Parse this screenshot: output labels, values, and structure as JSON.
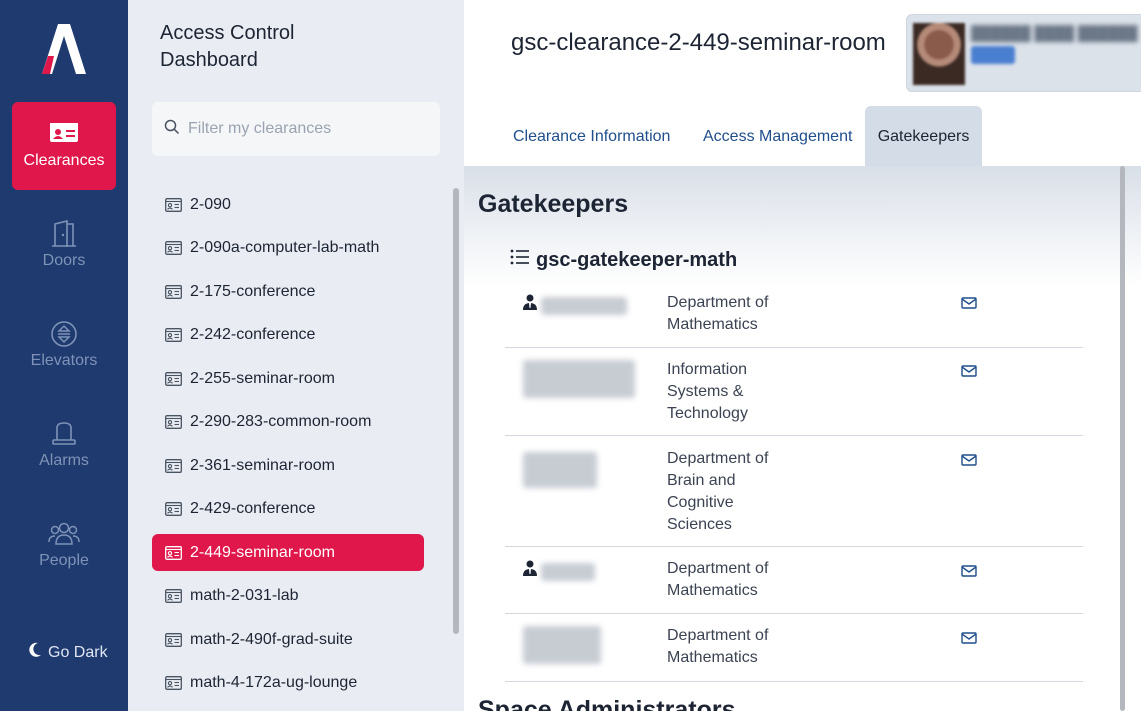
{
  "nav": {
    "items": [
      {
        "label": "Clearances",
        "icon": "id-card-icon"
      },
      {
        "label": "Doors",
        "icon": "door-icon"
      },
      {
        "label": "Elevators",
        "icon": "elevator-icon"
      },
      {
        "label": "Alarms",
        "icon": "alarm-icon"
      },
      {
        "label": "People",
        "icon": "people-icon"
      }
    ],
    "go_dark": "Go Dark",
    "active_color": "#e0174b",
    "rail_color": "#1e3a6e"
  },
  "panel": {
    "title": "Access Control Dashboard",
    "filter_placeholder": "Filter my clearances",
    "clearances": [
      "2-090",
      "2-090a-computer-lab-math",
      "2-175-conference",
      "2-242-conference",
      "2-255-seminar-room",
      "2-290-283-common-room",
      "2-361-seminar-room",
      "2-429-conference",
      "2-449-seminar-room",
      "math-2-031-lab",
      "math-2-490f-grad-suite",
      "math-4-172a-ug-lounge"
    ],
    "selected": "2-449-seminar-room"
  },
  "main": {
    "title": "gsc-clearance-2-449-seminar-room",
    "tabs": [
      "Clearance Information",
      "Access Management",
      "Gatekeepers"
    ],
    "active_tab": "Gatekeepers",
    "section_title": "Gatekeepers",
    "group_title": "gsc-gatekeeper-math",
    "gatekeepers": [
      {
        "department": "Department of Mathematics"
      },
      {
        "department": "Information Systems & Technology"
      },
      {
        "department": "Department of Brain and Cognitive Sciences"
      },
      {
        "department": "Department of Mathematics"
      },
      {
        "department": "Department of Mathematics"
      }
    ],
    "next_section": "Space Administrators"
  }
}
